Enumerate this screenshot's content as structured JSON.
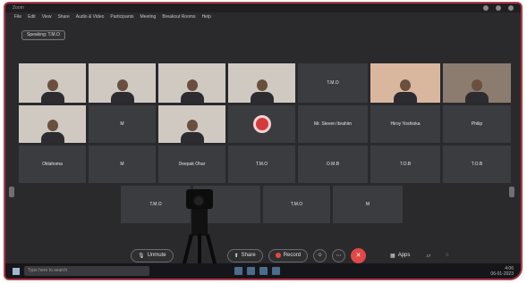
{
  "titlebar": {
    "title": "Zoom"
  },
  "menubar": [
    "File",
    "Edit",
    "View",
    "Share",
    "Audio & Video",
    "Participants",
    "Meeting",
    "Breakout Rooms",
    "Help"
  ],
  "speaking_label": "Speaking: T.M.O",
  "toolbar": {
    "unmute": "Unmute",
    "share": "Share",
    "record": "Record",
    "apps": "Apps"
  },
  "tiles": {
    "r1c5": "T.M.O",
    "r2c2": "M",
    "r2c5": "Mr. Steven Ibrahim",
    "r2c6": "Hiroy Yoshioka",
    "r2c7": "Philip",
    "r3c1": "Oklahoma",
    "r3c2": "M",
    "r3c3": "Deepak Ohar",
    "r3c4": "T.M.O",
    "r3c5": "O.M.B",
    "r3c6": "T.O.B",
    "r3c7": "T.O.B",
    "r4c1": "T.M.O",
    "r4c3": "T.M.O",
    "r4c4": "M"
  },
  "taskbar": {
    "search_placeholder": "Type here to search",
    "time": "4:06",
    "date": "06-01-2023"
  }
}
